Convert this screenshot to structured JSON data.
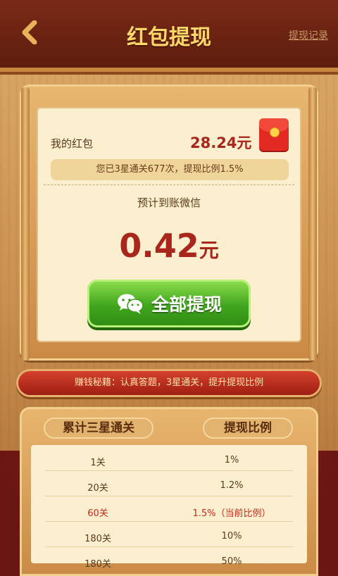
{
  "header": {
    "title": "红包提现",
    "record_link": "提现记录"
  },
  "wallet": {
    "label": "我的红包",
    "amount": "28.24元",
    "stats": "您已3星通关677次，提现比例1.5%"
  },
  "withdraw": {
    "expect_label": "预计到账微信",
    "amount": "0.42",
    "unit": "元",
    "button_label": "全部提现"
  },
  "tips": "赚钱秘籍：认真答题，3星通关，提升提现比例",
  "table": {
    "headers": [
      "累计三星通关",
      "提现比例"
    ],
    "rows": [
      {
        "levels": "1关",
        "ratio": "1%"
      },
      {
        "levels": "20关",
        "ratio": "1.2%"
      },
      {
        "levels": "60关",
        "ratio": "1.5%（当前比例）"
      },
      {
        "levels": "180关",
        "ratio": "10%"
      },
      {
        "levels": "180关",
        "ratio": "50%"
      }
    ]
  },
  "colors": {
    "accent_red": "#a8261c",
    "button_green": "#40a51e",
    "title_gold": "#ffd86a"
  },
  "icons": [
    "back-arrow-icon",
    "red-packet-icon",
    "wechat-icon"
  ]
}
